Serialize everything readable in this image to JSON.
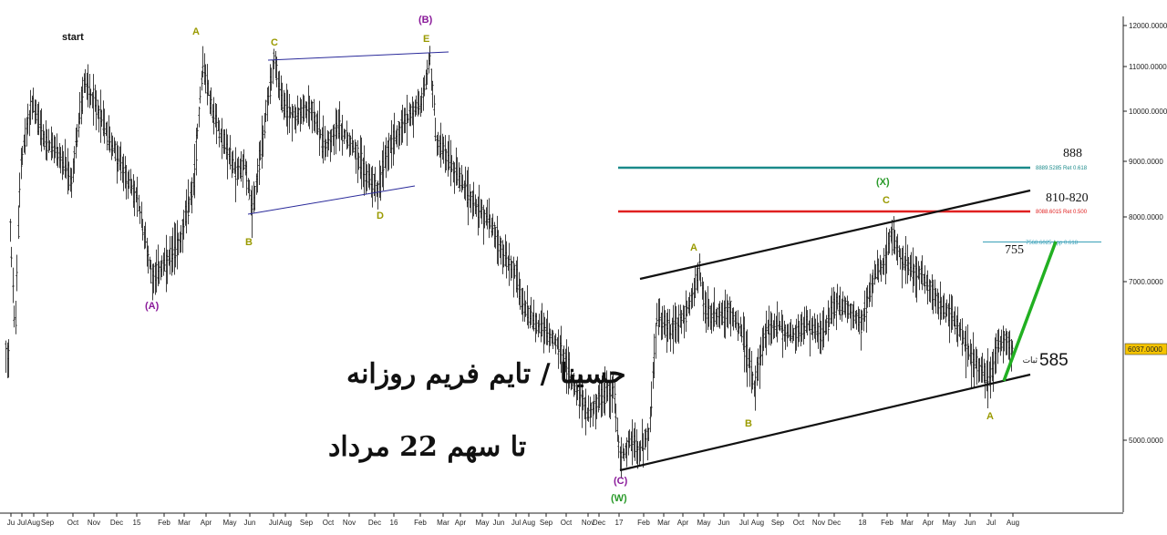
{
  "chart_data": {
    "type": "ohlc",
    "y_axis": {
      "ticks": [
        "12000.0000",
        "11000.0000",
        "10000.0000",
        "9000.0000",
        "8000.0000",
        "7000.0000",
        "5000.0000"
      ],
      "current_price_label": "6037.0000",
      "current_price": 6037
    },
    "x_axis": {
      "ticks": [
        "Ju",
        "Jul",
        "Aug",
        "Sep",
        "Oct",
        "Nov",
        "Dec",
        "15",
        "Feb",
        "Mar",
        "Apr",
        "May",
        "Jun",
        "Jul",
        "Aug",
        "Sep",
        "Oct",
        "Nov",
        "Dec",
        "16",
        "Feb",
        "Mar",
        "Apr",
        "May",
        "Jun",
        "Jul",
        "Aug",
        "Sep",
        "Oct",
        "Nov",
        "Dec",
        "17",
        "Feb",
        "Mar",
        "Apr",
        "May",
        "Jun",
        "Jul",
        "Aug",
        "Sep",
        "Oct",
        "Nov",
        "Dec",
        "18",
        "Feb",
        "Mar",
        "Apr",
        "May",
        "Jun",
        "Jul",
        "Aug"
      ]
    },
    "horizontal_levels": [
      {
        "label": "888",
        "annotation": "8889.5285 Ret 0.618",
        "value": 8889.5285,
        "color": "#1a8a8a"
      },
      {
        "label": "810-820",
        "annotation": "8088.6015 Ret 0.500",
        "value": 8088.6015,
        "color": "#e02020"
      },
      {
        "label": "755",
        "annotation": "7568.6025 App 0.618",
        "value": 7568.6025,
        "color": "#3aa0b8"
      }
    ],
    "wave_labels": [
      {
        "text": "start",
        "color": "#111111"
      },
      {
        "text": "A",
        "color": "#9a9a00"
      },
      {
        "text": "(B)",
        "color": "#8a1a9a"
      },
      {
        "text": "C",
        "color": "#9a9a00"
      },
      {
        "text": "E",
        "color": "#9a9a00"
      },
      {
        "text": "B",
        "color": "#9a9a00"
      },
      {
        "text": "D",
        "color": "#9a9a00"
      },
      {
        "text": "(A)",
        "color": "#8a1a9a"
      },
      {
        "text": "(X)",
        "color": "#2a9a2a"
      },
      {
        "text": "C",
        "color": "#9a9a00"
      },
      {
        "text": "A",
        "color": "#9a9a00"
      },
      {
        "text": "B",
        "color": "#9a9a00"
      },
      {
        "text": "A",
        "color": "#9a9a00"
      },
      {
        "text": "(C)",
        "color": "#8a1a9a"
      },
      {
        "text": "(W)",
        "color": "#2a9a2a"
      }
    ],
    "annotations": {
      "price_note": "585",
      "price_note_suffix": "ثبات",
      "farsi_line1": "حسینا / تایم فریم روزانه",
      "farsi_line2": "تا سهم 22 مرداد"
    },
    "colors": {
      "candles": "#111111",
      "channel": "#111111",
      "triangle": "#2a2a9a",
      "projection": "#22b022"
    }
  }
}
